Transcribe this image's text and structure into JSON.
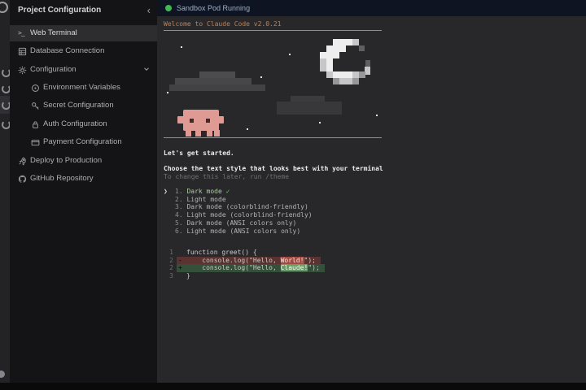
{
  "colors": {
    "status_dot_green": "#3fb950",
    "welcome_orange": "#c08057",
    "terminal_bg": "#28282a",
    "status_bar_bg": "#0e1422",
    "sidebar_bg": "#141416",
    "selected_row_bg": "#2d2d30",
    "diff_removed_bg": "#5a3330",
    "diff_added_bg": "#35503a",
    "creature_pink": "#e09a94"
  },
  "sidebar": {
    "title": "Project Configuration",
    "collapse_icon": "‹",
    "items": [
      {
        "label": "Web Terminal",
        "icon": "terminal-icon",
        "selected": true
      },
      {
        "label": "Database Connection",
        "icon": "database-icon"
      },
      {
        "label": "Configuration",
        "icon": "gear-icon",
        "expanded": true
      },
      {
        "label": "Environment Variables",
        "icon": "variables-icon"
      },
      {
        "label": "Secret Configuration",
        "icon": "key-icon"
      },
      {
        "label": "Auth Configuration",
        "icon": "lock-icon"
      },
      {
        "label": "Payment Configuration",
        "icon": "card-icon"
      },
      {
        "label": "Deploy to Production",
        "icon": "rocket-icon"
      },
      {
        "label": "GitHub Repository",
        "icon": "github-icon"
      }
    ]
  },
  "terminal": {
    "status_label": "Sandbox Pod Running",
    "welcome": "Welcome to Claude Code v2.0.21",
    "lets_get_started": "Let's get started.",
    "prompt_heading": "Choose the text style that looks best with your terminal",
    "prompt_subtext": "To change this later, run /theme",
    "selector": "❯",
    "options": [
      {
        "num": "1.",
        "label": "Dark mode",
        "check": "✓"
      },
      {
        "num": "2.",
        "label": "Light mode",
        "check": ""
      },
      {
        "num": "3.",
        "label": "Dark mode (colorblind-friendly)",
        "check": ""
      },
      {
        "num": "4.",
        "label": "Light mode (colorblind-friendly)",
        "check": ""
      },
      {
        "num": "5.",
        "label": "Dark mode (ANSI colors only)",
        "check": ""
      },
      {
        "num": "6.",
        "label": "Light mode (ANSI colors only)",
        "check": ""
      }
    ],
    "code": {
      "lines": [
        {
          "gutter": "1",
          "marker": "",
          "text": "function greet() {"
        },
        {
          "gutter": "2",
          "marker": "-",
          "pre": "    console.log(\"Hello, ",
          "word": "World!",
          "post": "\");"
        },
        {
          "gutter": "2",
          "marker": "+",
          "pre": "    console.log(\"Hello, ",
          "word": "Claude!",
          "post": "\");"
        },
        {
          "gutter": "3",
          "marker": "",
          "text": "}"
        }
      ]
    },
    "scene": {
      "elements": [
        "crescent-moon",
        "clouds",
        "stars",
        "pink-pixel-creature"
      ]
    }
  }
}
